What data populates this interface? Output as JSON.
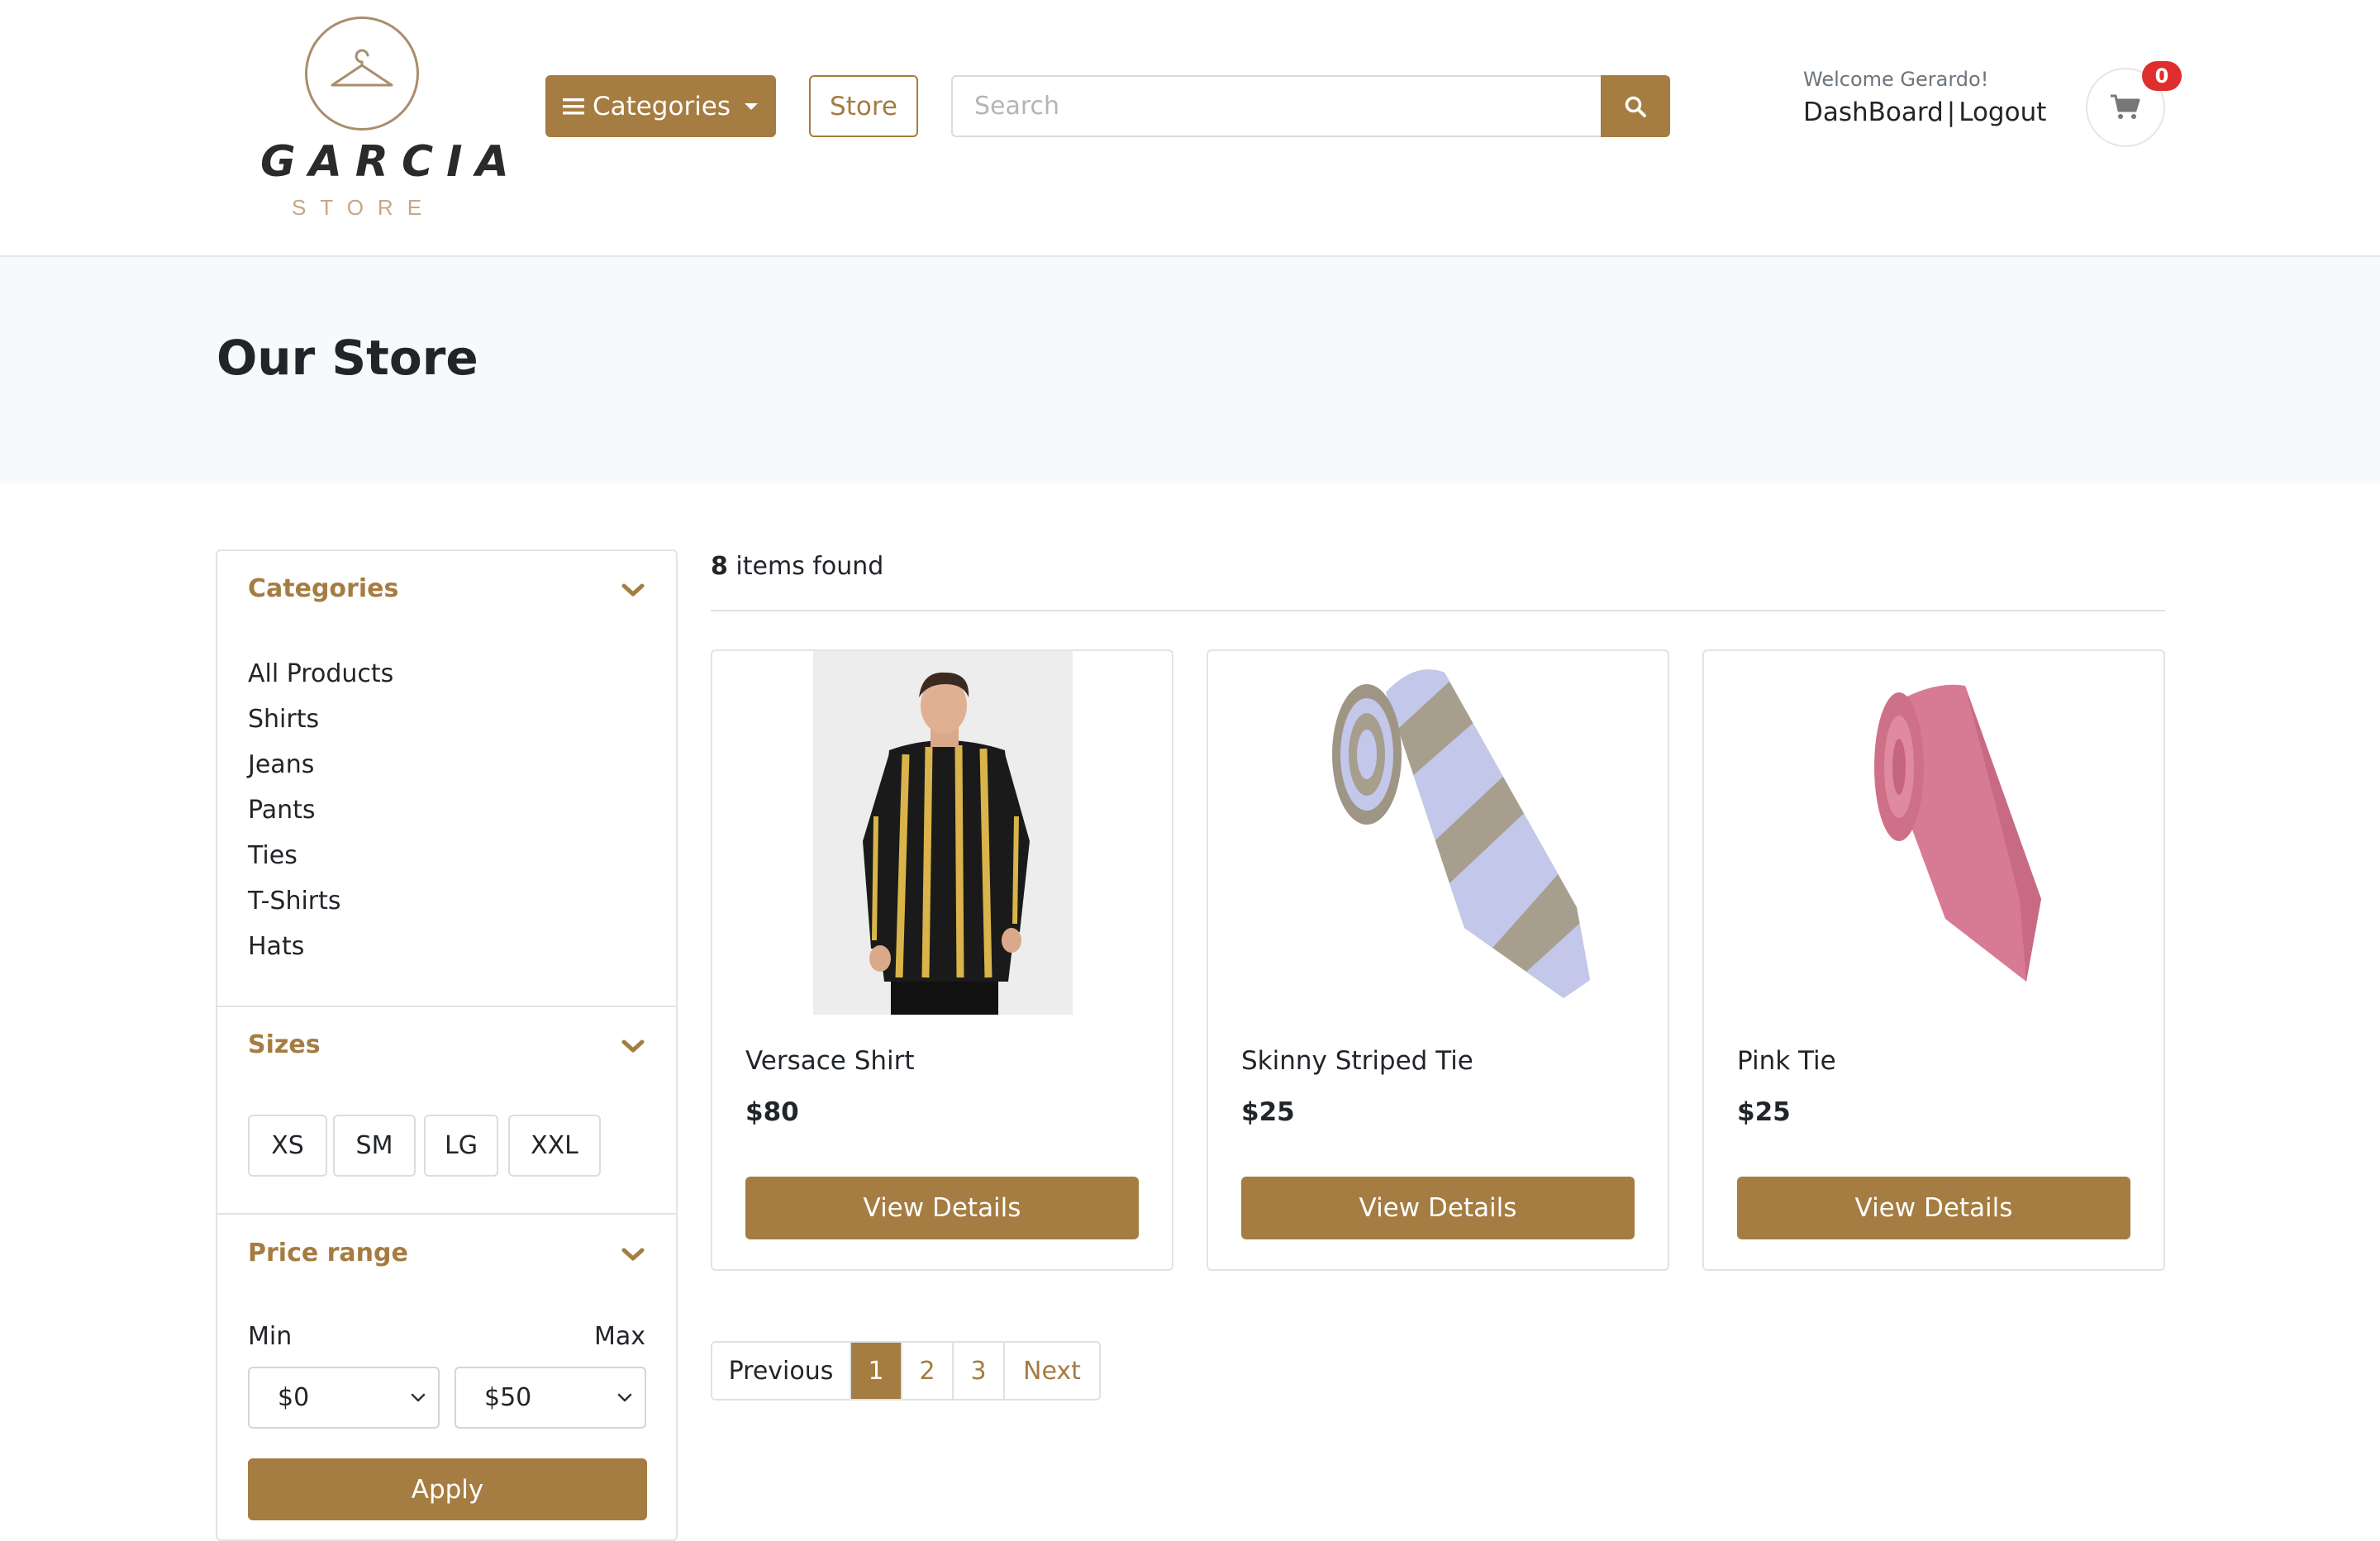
{
  "brand": {
    "logo_word": "GARCIA",
    "logo_sub": "STORE",
    "logo_icon": "hanger-icon"
  },
  "header": {
    "categories_label": "Categories",
    "store_label": "Store",
    "search_placeholder": "Search",
    "search_value": "",
    "welcome": "Welcome Gerardo!",
    "dashboard_label": "DashBoard",
    "separator": "|",
    "logout_label": "Logout",
    "cart_count": "0"
  },
  "hero": {
    "title": "Our Store"
  },
  "sidebar": {
    "categories_title": "Categories",
    "categories": [
      "All Products",
      "Shirts",
      "Jeans",
      "Pants",
      "Ties",
      "T-Shirts",
      "Hats"
    ],
    "sizes_title": "Sizes",
    "sizes": [
      "XS",
      "SM",
      "LG",
      "XXL"
    ],
    "price_title": "Price range",
    "min_label": "Min",
    "max_label": "Max",
    "min_value": "$0",
    "max_value": "$50",
    "apply_label": "Apply"
  },
  "results": {
    "count": "8",
    "count_suffix": " items found"
  },
  "products": [
    {
      "name": "Versace Shirt",
      "price": "$80",
      "button": "View Details"
    },
    {
      "name": "Skinny Striped Tie",
      "price": "$25",
      "button": "View Details"
    },
    {
      "name": "Pink Tie",
      "price": "$25",
      "button": "View Details"
    }
  ],
  "pagination": {
    "previous": "Previous",
    "pages": [
      "1",
      "2",
      "3"
    ],
    "active_page": "1",
    "next": "Next"
  },
  "colors": {
    "accent": "#a57c41",
    "hero_bg": "#f8f9fa",
    "badge": "#e02d2d"
  }
}
